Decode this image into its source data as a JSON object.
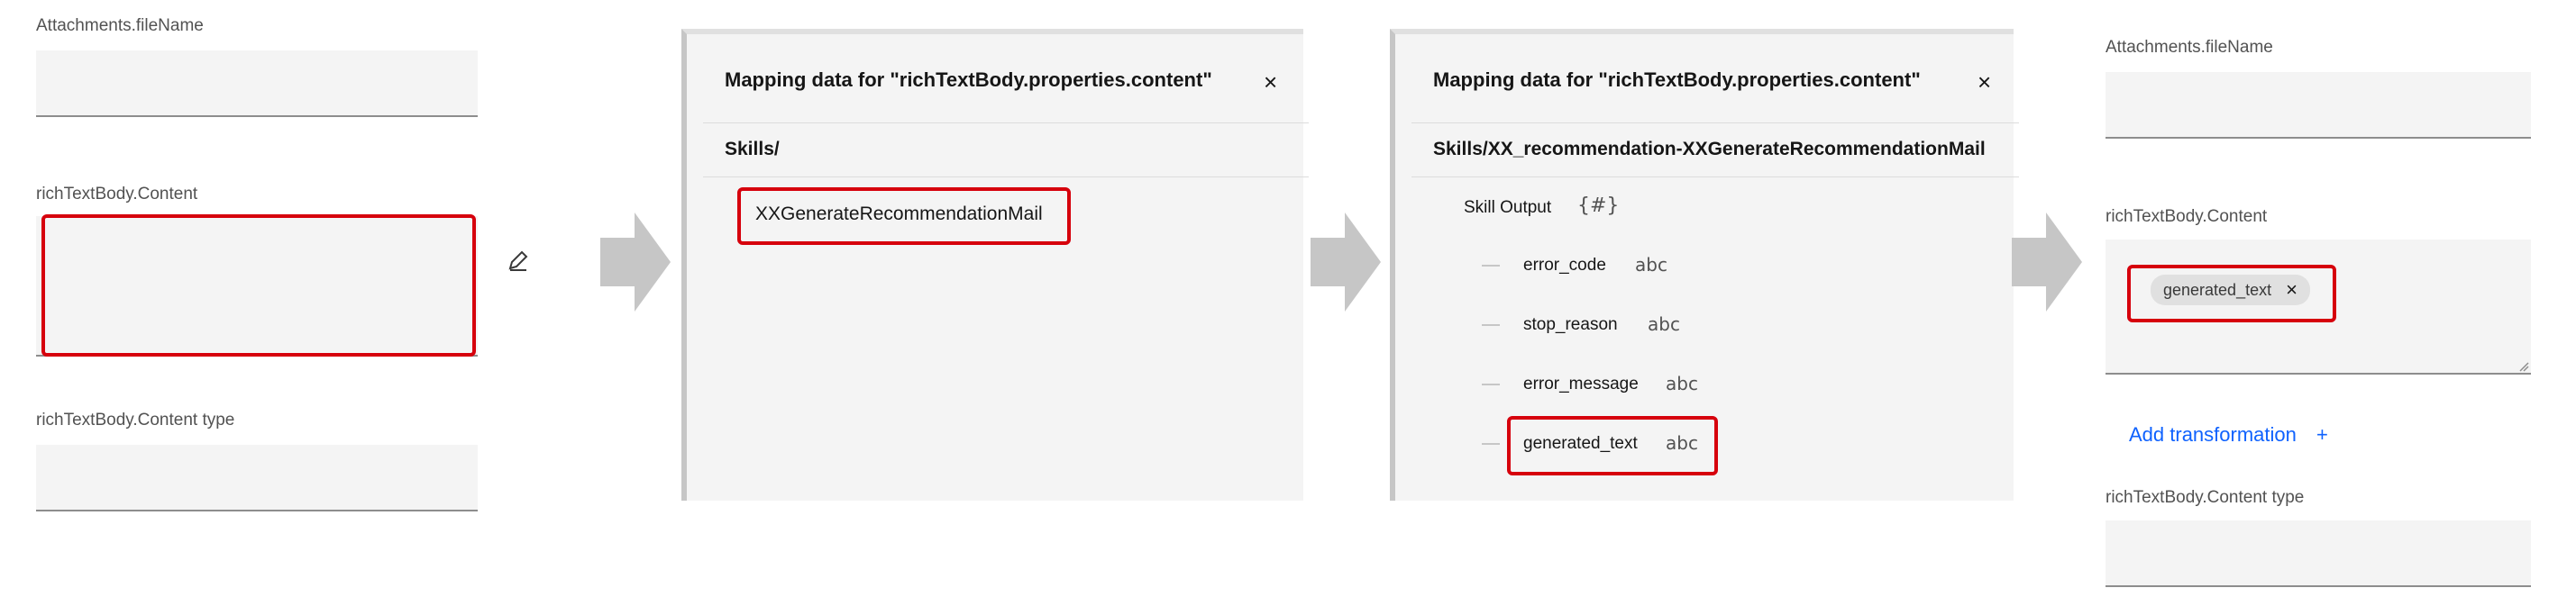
{
  "left_form": {
    "label_filename": "Attachments.fileName",
    "label_content": "richTextBody.Content",
    "label_content_type": "richTextBody.Content type",
    "edit_icon": "pencil-icon"
  },
  "panel_skills": {
    "title": "Mapping data for \"richTextBody.properties.content\"",
    "close": "×",
    "path": "Skills/",
    "item": "XXGenerateRecommendationMail"
  },
  "panel_output": {
    "title": "Mapping data for \"richTextBody.properties.content\"",
    "close": "×",
    "path": "Skills/XX_recommendation-XXGenerateRecommendationMail",
    "root_label": "Skill Output",
    "root_type": "{#}",
    "fields": [
      {
        "name": "error_code",
        "type": "abc"
      },
      {
        "name": "stop_reason",
        "type": "abc"
      },
      {
        "name": "error_message",
        "type": "abc"
      },
      {
        "name": "generated_text",
        "type": "abc"
      }
    ]
  },
  "right_form": {
    "label_filename": "Attachments.fileName",
    "label_content": "richTextBody.Content",
    "tag": "generated_text",
    "tag_remove": "×",
    "add_transformation": "Add transformation",
    "add_icon": "+",
    "label_content_type": "richTextBody.Content type"
  },
  "colors": {
    "highlight": "#d6000c",
    "field_bg": "#f4f4f4",
    "arrow": "#c6c6c6",
    "link": "#0f62fe"
  }
}
